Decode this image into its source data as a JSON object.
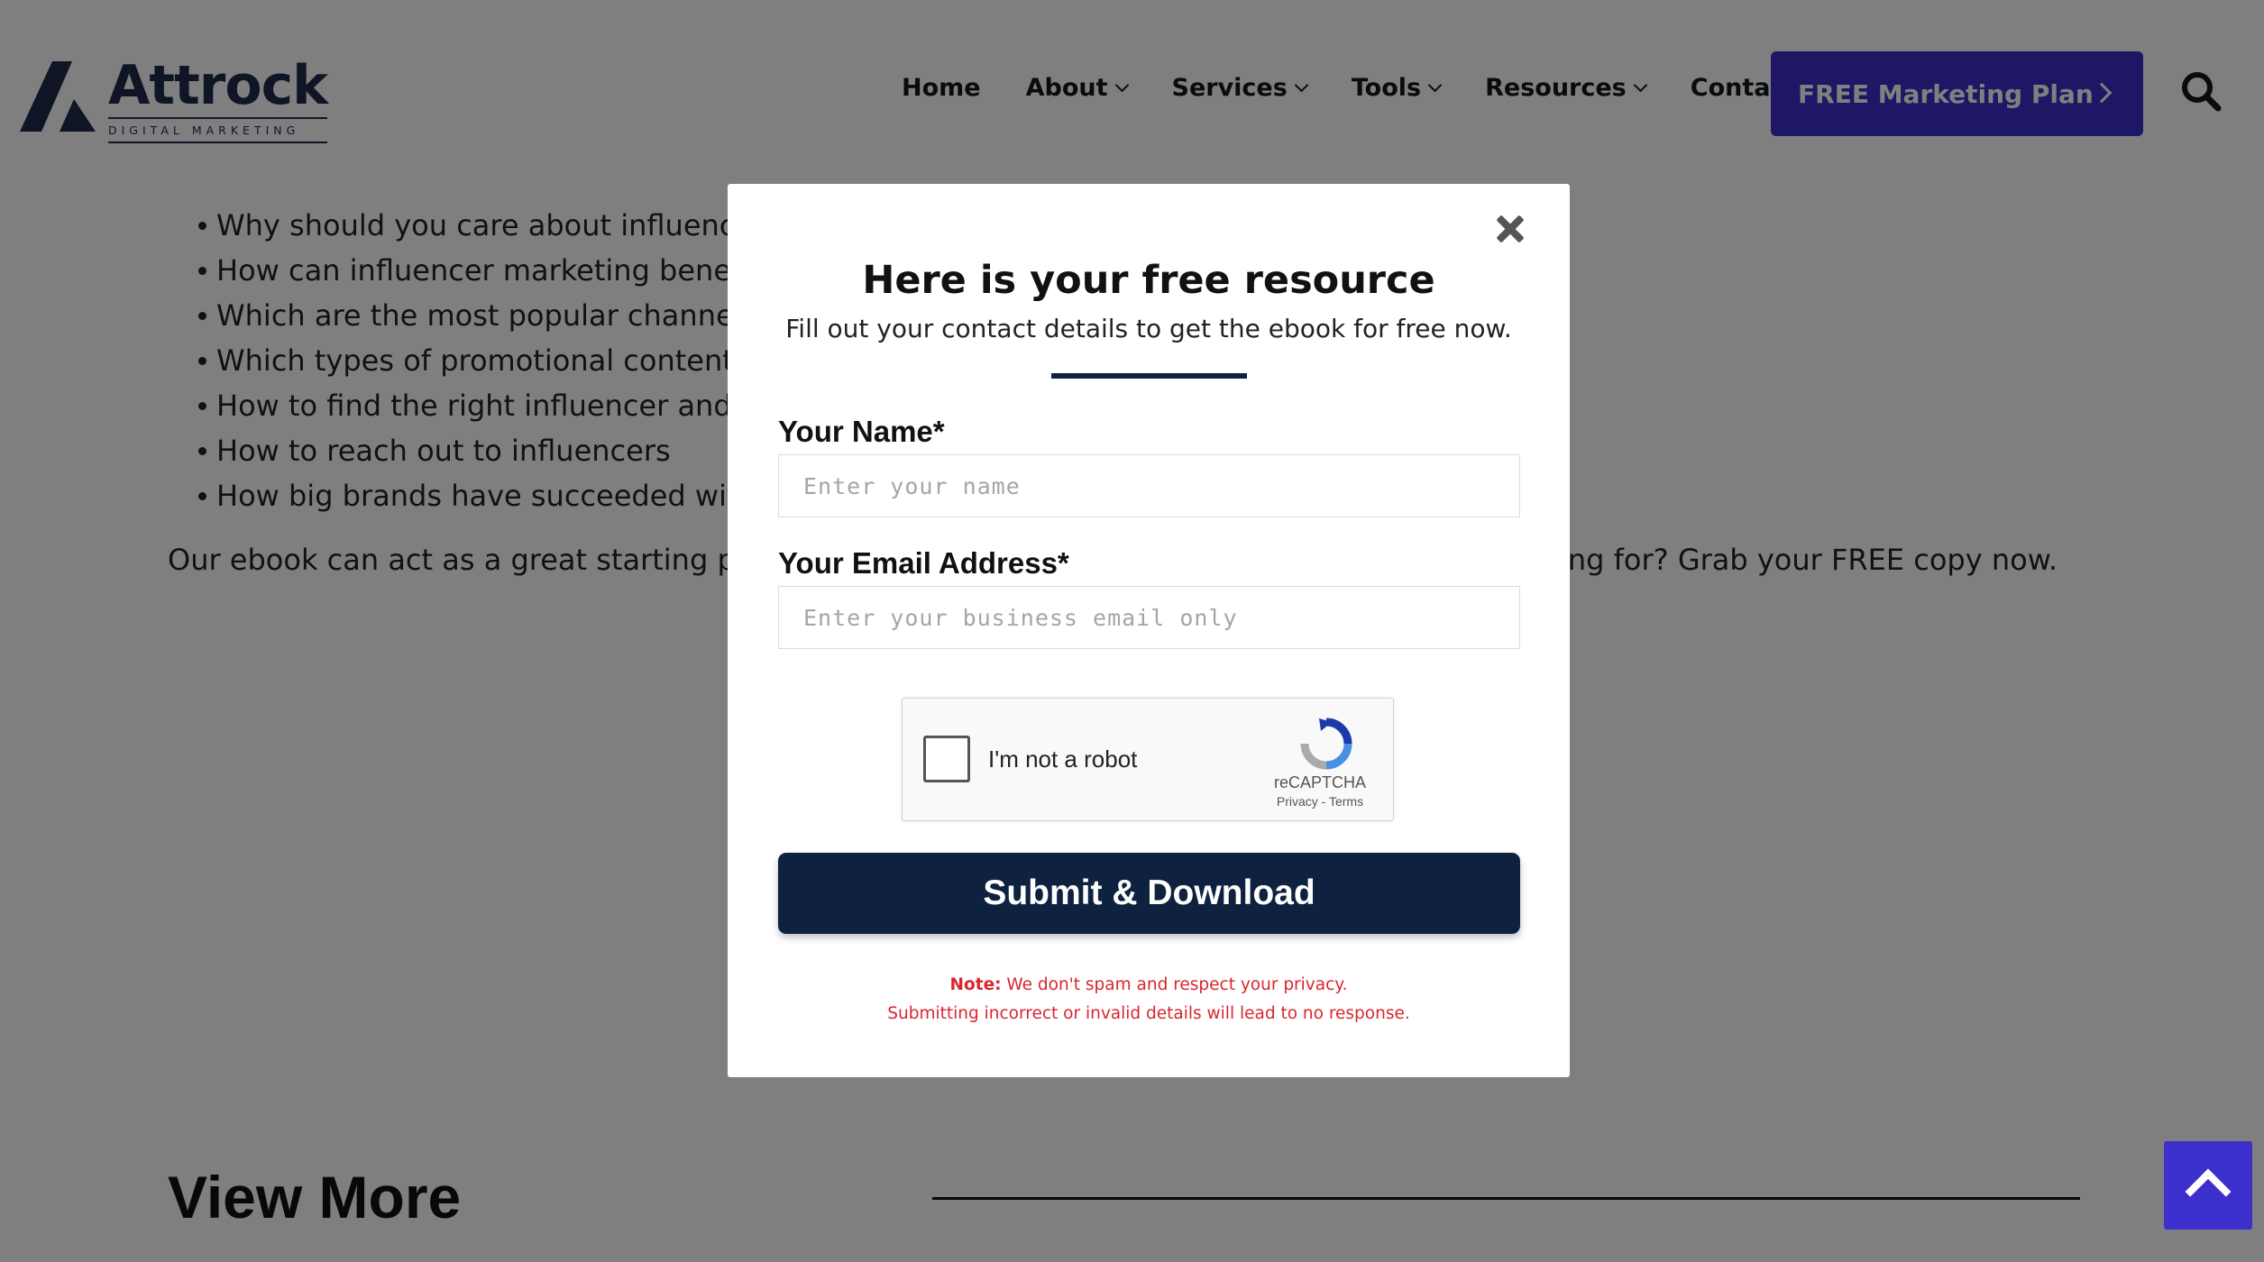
{
  "brand": {
    "name": "Attrock",
    "tagline": "DIGITAL MARKETING"
  },
  "nav": {
    "items": [
      {
        "label": "Home",
        "has_dropdown": false
      },
      {
        "label": "About",
        "has_dropdown": true
      },
      {
        "label": "Services",
        "has_dropdown": true
      },
      {
        "label": "Tools",
        "has_dropdown": true
      },
      {
        "label": "Resources",
        "has_dropdown": true
      },
      {
        "label": "Contact",
        "has_dropdown": false
      }
    ],
    "cta_label": "FREE Marketing Plan",
    "search_icon": "search-icon"
  },
  "article": {
    "bullets": [
      "Why should you care about influence",
      "How can influencer marketing benefi",
      "Which are the most popular channels",
      "Which types of promotional content",
      "How to find the right influencer and t",
      "How to reach out to influencers",
      "How big brands have succeeded wit"
    ],
    "paragraph_start": "Our ebook can act as a great starting point",
    "paragraph_end": "ing for? Grab your FREE copy now.",
    "view_more": "View More"
  },
  "modal": {
    "title": "Here is your free resource",
    "subtitle": "Fill out your contact details to get the ebook for free now.",
    "name_label": "Your Name*",
    "name_placeholder": "Enter your name",
    "name_value": "",
    "email_label": "Your Email Address*",
    "email_placeholder": "Enter your business email only",
    "email_value": "",
    "recaptcha": {
      "label": "I'm not a robot",
      "brand": "reCAPTCHA",
      "links": "Privacy - Terms",
      "checked": false
    },
    "submit_label": "Submit & Download",
    "note_prefix": "Note:",
    "note_line1": "We don't spam and respect your privacy.",
    "note_line2": "Submitting incorrect or invalid details will lead to no response."
  },
  "colors": {
    "accent": "#3d2fcc",
    "navy": "#0e2240",
    "note_red": "#d8262e",
    "overlay": "rgba(0,0,0,0.5)"
  }
}
